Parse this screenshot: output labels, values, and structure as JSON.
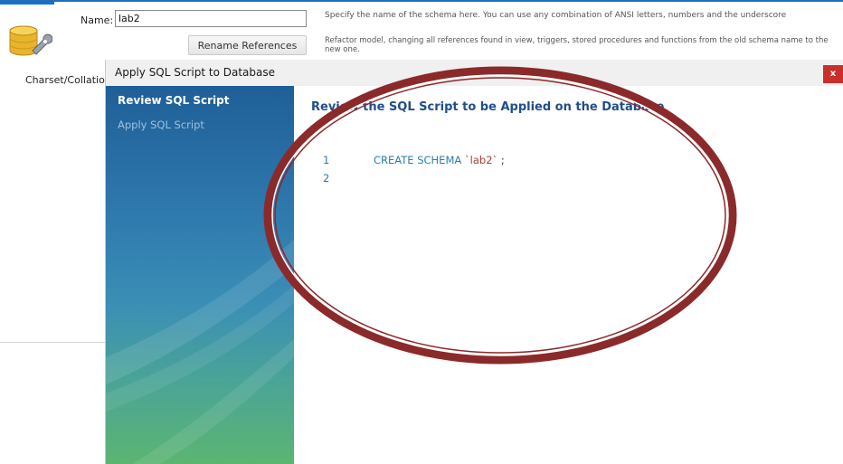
{
  "schema_editor": {
    "name_label": "Name:",
    "name_value": "lab2",
    "name_hint": "Specify the name of the schema here. You can use any combination of ANSI letters, numbers and the underscore",
    "rename_button": "Rename References",
    "rename_hint": "Refactor model, changing all references found in view, triggers, stored procedures and functions from the old schema name to the new one.",
    "charset_label": "Charset/Collation:"
  },
  "dialog": {
    "title": "Apply SQL Script to Database",
    "close_label": "x",
    "steps": [
      {
        "label": "Review SQL Script",
        "active": true
      },
      {
        "label": "Apply SQL Script",
        "active": false
      }
    ],
    "content_title": "Review the SQL Script to be Applied on the Database",
    "script": {
      "lines": [
        {
          "number": "1",
          "keyword": "CREATE SCHEMA ",
          "string": "`lab2`",
          "punct": " ;"
        },
        {
          "number": "2",
          "keyword": "",
          "string": "",
          "punct": ""
        }
      ]
    }
  },
  "colors": {
    "accent": "#1e6fc0",
    "sidebar_top": "#1f5f98",
    "sidebar_bottom": "#5cb571",
    "annotation_ellipse": "#8b2a2a",
    "close_button": "#c9302c",
    "content_title": "#1f4e8a",
    "sql_keyword": "#2a7fb0",
    "sql_string": "#b03d3d"
  }
}
